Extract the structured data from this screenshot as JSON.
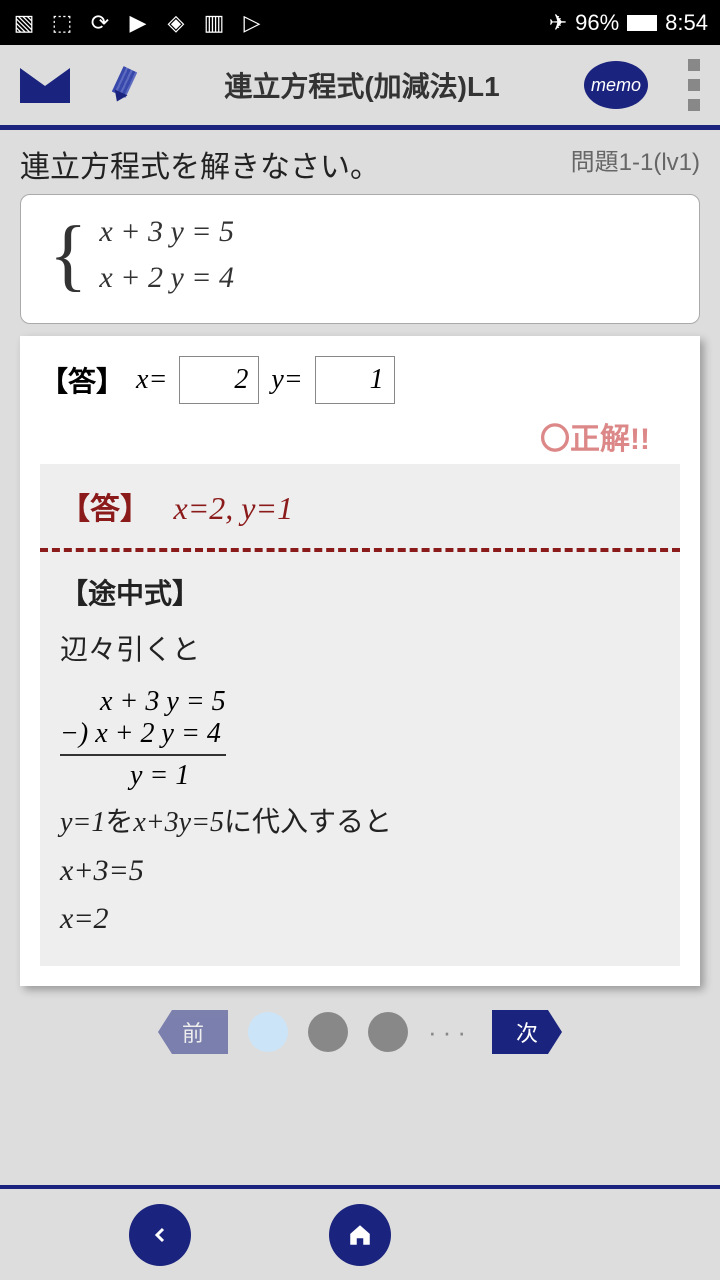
{
  "status": {
    "battery": "96%",
    "time": "8:54"
  },
  "header": {
    "title": "連立方程式(加減法)L1",
    "memo_label": "memo"
  },
  "problem": {
    "instruction": "連立方程式を解きなさい。",
    "number": "問題1-1(lv1)",
    "equation1": "x + 3 y = 5",
    "equation2": "x + 2 y = 4"
  },
  "answer": {
    "label": "【答】",
    "x_label": "x=",
    "y_label": "y=",
    "x_value": "2",
    "y_value": "1",
    "correct_msg": "〇正解!!"
  },
  "solution": {
    "answer_label": "【答】",
    "answer_text": "x=2, y=1",
    "steps_label": "【途中式】",
    "step1": "辺々引くと",
    "sub_top": "x + 3 y = 5",
    "sub_bot": "−) x + 2 y = 4",
    "sub_res": "y    = 1",
    "step2a": "y=1",
    "step2b": "を",
    "step2c": "x+3y=5",
    "step2d": "に代入すると",
    "step3": "x+3=5",
    "step4": "x=2"
  },
  "nav": {
    "prev": "前",
    "next": "次"
  }
}
